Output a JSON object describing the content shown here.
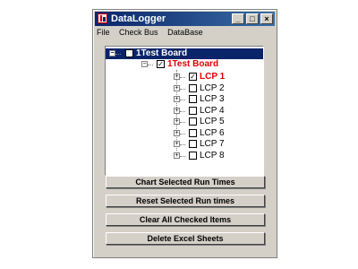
{
  "window": {
    "title": "DataLogger"
  },
  "menu": [
    "File",
    "Check Bus",
    "DataBase"
  ],
  "tree": {
    "root_label": "1Test Board",
    "board_label": "1Test Board",
    "items": [
      {
        "label": "LCP 1",
        "checked": true
      },
      {
        "label": "LCP 2",
        "checked": false
      },
      {
        "label": "LCP 3",
        "checked": false
      },
      {
        "label": "LCP 4",
        "checked": false
      },
      {
        "label": "LCP 5",
        "checked": false
      },
      {
        "label": "LCP 6",
        "checked": false
      },
      {
        "label": "LCP 7",
        "checked": false
      },
      {
        "label": "LCP 8",
        "checked": false
      }
    ]
  },
  "buttons": {
    "chart": "Chart Selected Run Times",
    "reset": "Reset Selected Run times",
    "clear": "Clear All Checked Items",
    "delete": "Delete Excel Sheets"
  },
  "colors": {
    "title_bar": "#0a246a",
    "selected": "#0a246a",
    "highlight_text": "#e00000",
    "face": "#d4d0c8"
  }
}
